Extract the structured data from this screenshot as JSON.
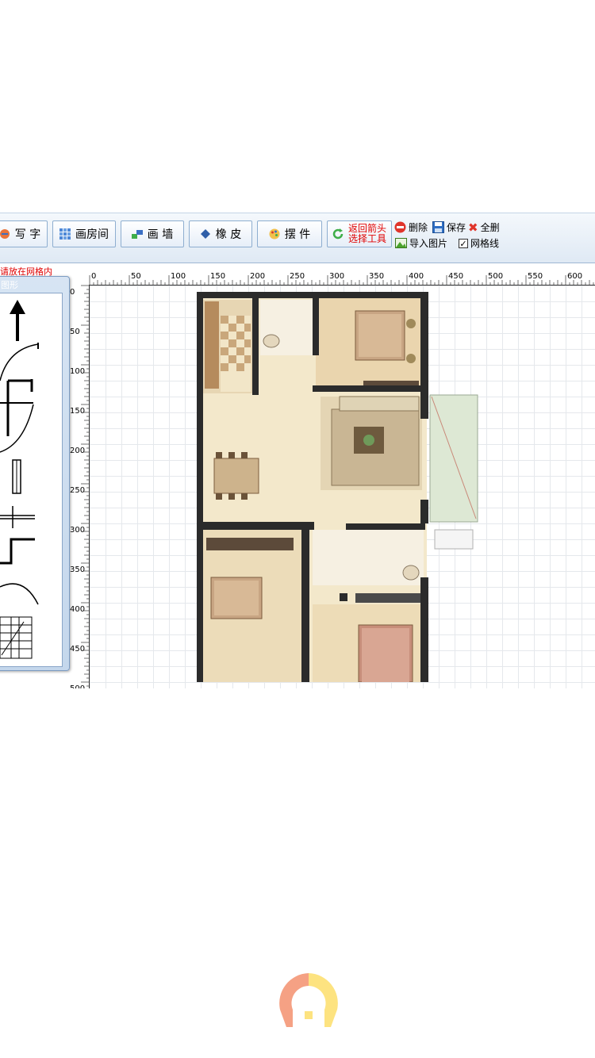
{
  "toolbar": {
    "buttons": [
      {
        "label": "写 字",
        "icon": "pencil-icon"
      },
      {
        "label": "画房间",
        "icon": "grid-icon"
      },
      {
        "label": "画 墙",
        "icon": "wall-icon"
      },
      {
        "label": "橡 皮",
        "icon": "eraser-icon"
      },
      {
        "label": "摆 件",
        "icon": "palette-icon"
      }
    ],
    "back_button": {
      "line1": "返回箭头",
      "line2": "选择工具",
      "icon": "refresh-icon"
    },
    "actions": {
      "delete": "删除",
      "save": "保存",
      "clear_all": "全删",
      "import_image": "导入图片",
      "grid_lines": "网格线",
      "grid_lines_checked": "✓"
    }
  },
  "hint_text": "请放在网格内",
  "palette": {
    "title": "图形"
  },
  "ruler": {
    "top_labels": [
      "0",
      "50",
      "100",
      "150",
      "200",
      "250",
      "300",
      "350",
      "400",
      "450",
      "500",
      "550",
      "600"
    ],
    "left_labels": [
      "0",
      "50",
      "100",
      "150",
      "200",
      "250",
      "300",
      "350",
      "400",
      "450",
      "500"
    ]
  },
  "colors": {
    "accent": "#8eaed0",
    "hint": "#e00000",
    "wall": "#2b2b2b",
    "floor": "#f1e5c4",
    "logo_orange": "#f5a184",
    "logo_yellow": "#fde380"
  }
}
